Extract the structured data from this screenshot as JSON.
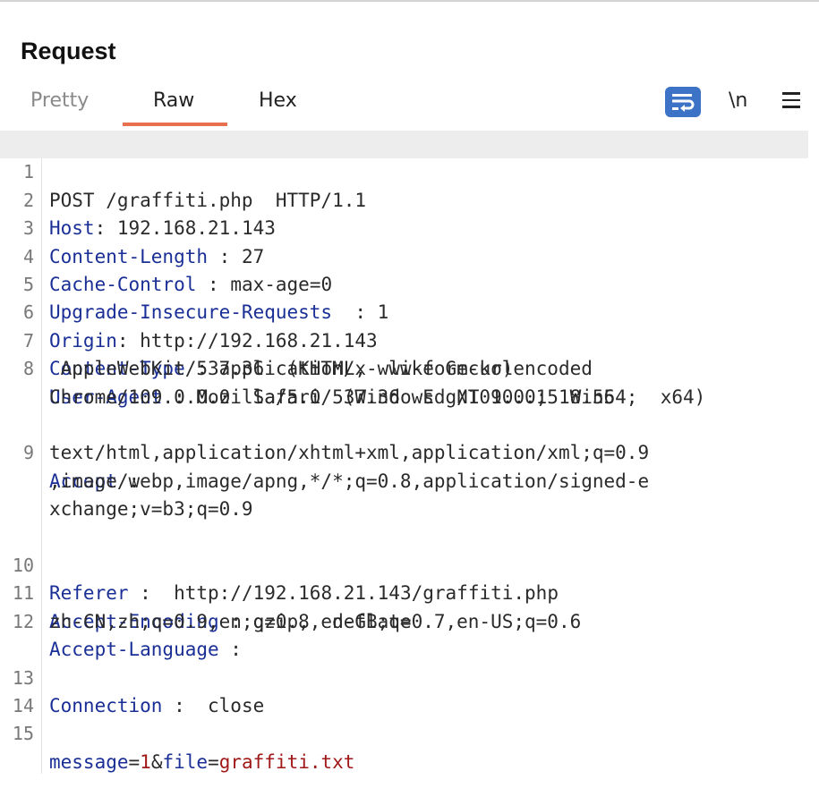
{
  "title": "Request",
  "tabs": [
    {
      "label": "Pretty"
    },
    {
      "label": "Raw"
    },
    {
      "label": "Hex"
    }
  ],
  "active_tab": "Raw",
  "toolbar": {
    "wrap_icon": "text-wrap-icon",
    "newline_label": "\\n",
    "menu_icon": "hamburger-menu-icon"
  },
  "colors": {
    "accent_tab_underline": "#e8704f",
    "wrap_button_bg": "#3d73c6",
    "header_key": "#1a2f96",
    "param_value": "#a01818",
    "line_highlight": "#ededed"
  },
  "request": {
    "line1": {
      "num": "1",
      "text": "POST /graffiti.php  HTTP/1.1"
    },
    "line2": {
      "num": "2",
      "key": "Host",
      "sep": ": ",
      "value": "192.168.21.143"
    },
    "line3": {
      "num": "3",
      "key": "Content-Length",
      "sep": " : ",
      "value": "27"
    },
    "line4": {
      "num": "4",
      "key": "Cache-Control",
      "sep": " : ",
      "value": "max-age=0"
    },
    "line5": {
      "num": "5",
      "key": "Upgrade-Insecure-Requests",
      "sep": "  : ",
      "value": "1"
    },
    "line6": {
      "num": "6",
      "key": "Origin",
      "sep": ": ",
      "value": "http://192.168.21.143"
    },
    "line7": {
      "num": "7",
      "key": "Content-Type",
      "sep": " : ",
      "value": "application/x-www-form-urlencoded"
    },
    "line8": {
      "num": "8",
      "key": "User-Agent",
      "sep": " : ",
      "value": "Mozilla/5.0  (Windows  NT 10.0;  Win64;  x64)",
      "cont1": " AppleWebKit/537.36  (KHTML,  like Gecko)",
      "cont2": "Chrome/109.0.0.0  Safari/537.36  Edg/109.0.1518.55"
    },
    "line9": {
      "num": "9",
      "key": "Accept",
      "sep": " :",
      "cont1": "text/html,application/xhtml+xml,application/xml;q=0.9",
      "cont2": ",image/webp,image/apng,*/*;q=0.8,application/signed-e",
      "cont3": "xchange;v=b3;q=0.9"
    },
    "line10": {
      "num": "10",
      "key": "Referer",
      "sep": " :  ",
      "value": "http://192.168.21.143/graffiti.php"
    },
    "line11": {
      "num": "11",
      "key": "Accept-Encoding",
      "sep": " : ",
      "value": "gzip,  deflate"
    },
    "line12": {
      "num": "12",
      "key": "Accept-Language",
      "sep": " :",
      "cont1": "zh-CN,zh;q=0.9,en;q=0.8,en-GB;q=0.7,en-US;q=0.6"
    },
    "line13": {
      "num": "13",
      "key": "Connection",
      "sep": " :  ",
      "value": "close"
    },
    "line14": {
      "num": "14"
    },
    "line15": {
      "num": "15",
      "k1": "message",
      "eq1": "=",
      "v1": "1",
      "amp": "&",
      "k2": "file",
      "eq2": "=",
      "v2": "graffiti.txt"
    }
  }
}
